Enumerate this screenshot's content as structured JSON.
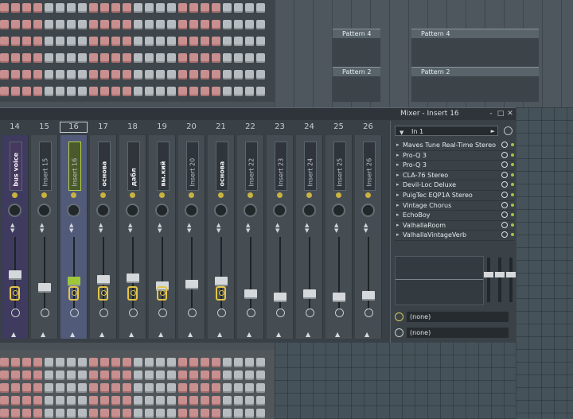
{
  "playlist": {
    "patterns": [
      "Pattern 4",
      "Pattern 4",
      "Pattern 2",
      "Pattern 2"
    ]
  },
  "mixer": {
    "title": "Mixer - Insert 16",
    "buttons": {
      "minimize": "-",
      "maximize": "□",
      "close": "✕"
    },
    "track_numbers": [
      "14",
      "15",
      "16",
      "17",
      "18",
      "19",
      "20",
      "21",
      "22",
      "23",
      "24",
      "25",
      "26"
    ],
    "selected_track": "16",
    "tracks": [
      {
        "label": "bus voice"
      },
      {
        "label": "Insert 15"
      },
      {
        "label": "Insert 16"
      },
      {
        "label": "основа"
      },
      {
        "label": "дабл"
      },
      {
        "label": "вы.кий"
      },
      {
        "label": "Insert 20"
      },
      {
        "label": "основа"
      },
      {
        "label": "Insert 22"
      },
      {
        "label": "Insert 23"
      },
      {
        "label": "Insert 24"
      },
      {
        "label": "Insert 25"
      },
      {
        "label": "Insert 26"
      }
    ],
    "insert": {
      "input": "In 1",
      "slots": [
        "Maves Tune Real-Time Stereo",
        "Pro-Q 3",
        "Pro-Q 3",
        "CLA-76 Stereo",
        "Devil-Loc Deluxe",
        "PuigTec EQP1A Stereo",
        "Vintage Chorus",
        "EchoBoy",
        "ValhallaRoom",
        "ValhallaVintageVerb"
      ],
      "send_1": "(none)",
      "send_2": "(none)"
    }
  },
  "colors": {
    "accent": "#9ec83a",
    "bus": "#3f3b5e",
    "link": "#e3c447"
  }
}
